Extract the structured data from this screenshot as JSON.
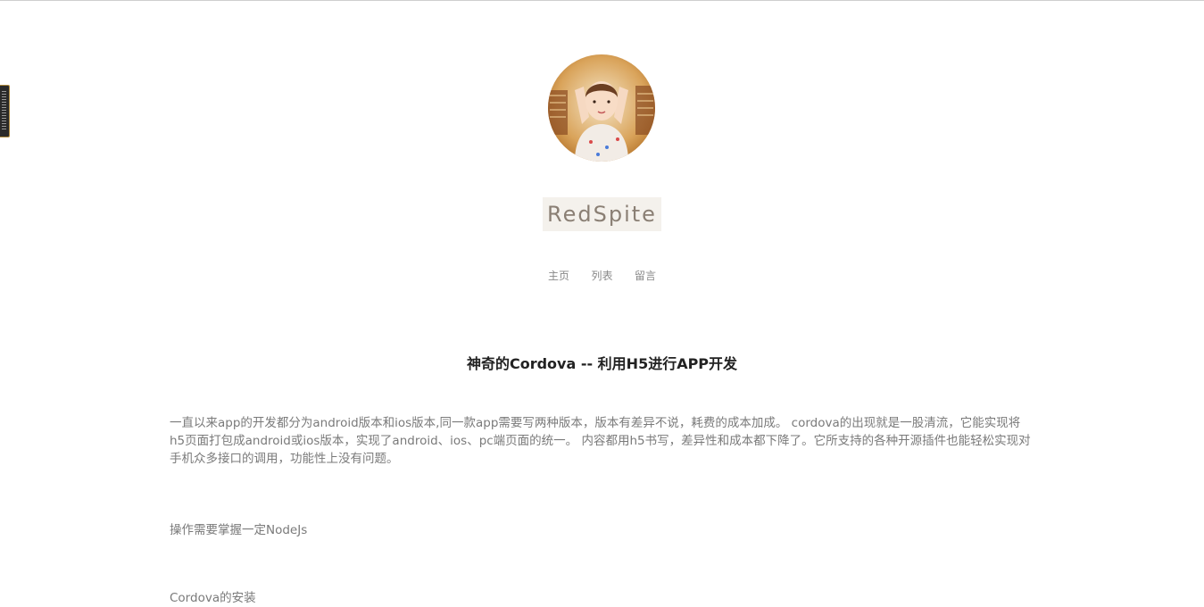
{
  "site": {
    "brand": "RedSpite",
    "avatar_alt": "avatar"
  },
  "nav": {
    "items": [
      {
        "label": "主页"
      },
      {
        "label": "列表"
      },
      {
        "label": "留言"
      }
    ]
  },
  "post": {
    "title": "神奇的Cordova -- 利用H5进行APP开发",
    "paragraphs": [
      "一直以来app的开发都分为android版本和ios版本,同一款app需要写两种版本，版本有差异不说，耗费的成本加成。 cordova的出现就是一股清流，它能实现将h5页面打包成android或ios版本，实现了android、ios、pc端页面的统一。 内容都用h5书写，差异性和成本都下降了。它所支持的各种开源插件也能轻松实现对手机众多接口的调用，功能性上没有问题。",
      "操作需要掌握一定NodeJs",
      "Cordova的安装"
    ]
  },
  "colors": {
    "brand_bg": "#f4f1ec",
    "brand_text": "#8a7f74",
    "title": "#222222",
    "body_text": "#7a7a7a"
  }
}
